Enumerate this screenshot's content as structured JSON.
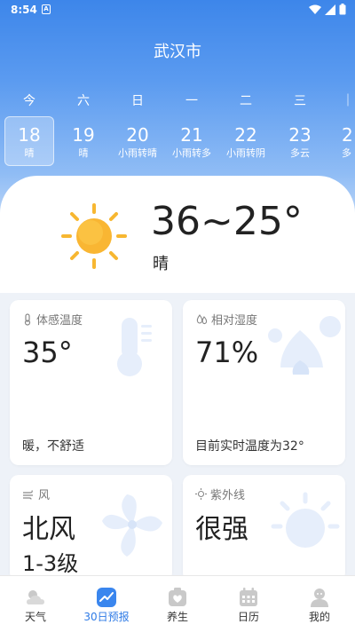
{
  "status_bar": {
    "time": "8:54",
    "sim_badge": "A"
  },
  "city": "武汉市",
  "days": [
    {
      "weekday": "今",
      "date": "18",
      "condition": "晴",
      "selected": true
    },
    {
      "weekday": "六",
      "date": "19",
      "condition": "晴",
      "selected": false
    },
    {
      "weekday": "日",
      "date": "20",
      "condition": "小雨转晴",
      "selected": false
    },
    {
      "weekday": "一",
      "date": "21",
      "condition": "小雨转多",
      "selected": false
    },
    {
      "weekday": "二",
      "date": "22",
      "condition": "小雨转阴",
      "selected": false
    },
    {
      "weekday": "三",
      "date": "23",
      "condition": "多云",
      "selected": false
    },
    {
      "weekday": "四",
      "date": "2",
      "condition": "多",
      "selected": false
    }
  ],
  "today": {
    "temp_range": "36~25°",
    "condition": "晴",
    "icon": "sun-icon"
  },
  "cards": {
    "feels_like": {
      "title": "体感温度",
      "value": "35°",
      "note": "暖，不舒适",
      "icon": "thermometer-icon"
    },
    "humidity": {
      "title": "相对湿度",
      "value": "71%",
      "note": "目前实时温度为32°",
      "icon": "droplet-icon"
    },
    "wind": {
      "title": "风",
      "direction": "北风",
      "level": "1-3级",
      "icon": "wind-icon"
    },
    "uv": {
      "title": "紫外线",
      "value": "很强",
      "icon": "uv-sun-icon"
    }
  },
  "nav": [
    {
      "label": "天气",
      "icon": "weather-icon",
      "active": false
    },
    {
      "label": "30日预报",
      "icon": "trend-chart-icon",
      "active": true
    },
    {
      "label": "养生",
      "icon": "health-icon",
      "active": false
    },
    {
      "label": "日历",
      "icon": "calendar-icon",
      "active": false
    },
    {
      "label": "我的",
      "icon": "profile-icon",
      "active": false
    }
  ],
  "colors": {
    "accent": "#2f7be6",
    "sun": "#f7b731",
    "header": "#4a8fec"
  }
}
